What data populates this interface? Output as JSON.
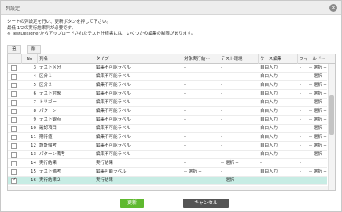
{
  "dialog": {
    "title": "列設定"
  },
  "notes": [
    "シートの列設定を行い、更新ボタンを押して下さい。",
    "最低 1つの実行結果列が必要です。",
    "※ TestDesignerからアップロードされたテスト仕様書には、いくつかの編集の制限があります。"
  ],
  "tabs": [
    "追加",
    "削除"
  ],
  "columns": [
    "No",
    "列名",
    "タイプ",
    "対象実行結⋯",
    "テスト環境",
    "ケース編集",
    "フィールド⋯"
  ],
  "rows": [
    {
      "checked": false,
      "no": "3",
      "name": "テスト区分",
      "type": "編集不可能ラベル",
      "target": "-",
      "env": "-",
      "edit": "自由入力",
      "field": "-"
    },
    {
      "checked": false,
      "no": "4",
      "name": "区分１",
      "type": "編集不可能ラベル",
      "target": "-",
      "env": "-",
      "edit": "自由入力",
      "field": "-"
    },
    {
      "checked": false,
      "no": "5",
      "name": "区分２",
      "type": "編集不可能ラベル",
      "target": "-",
      "env": "-",
      "edit": "自由入力",
      "field": "-"
    },
    {
      "checked": false,
      "no": "6",
      "name": "テスト対象",
      "type": "編集不可能ラベル",
      "target": "-",
      "env": "-",
      "edit": "自由入力",
      "field": "-"
    },
    {
      "checked": false,
      "no": "7",
      "name": "トリガー",
      "type": "編集不可能ラベル",
      "target": "-",
      "env": "-",
      "edit": "自由入力",
      "field": "-"
    },
    {
      "checked": false,
      "no": "8",
      "name": "パターン",
      "type": "編集不可能ラベル",
      "target": "-",
      "env": "-",
      "edit": "自由入力",
      "field": "-"
    },
    {
      "checked": false,
      "no": "9",
      "name": "テスト観点",
      "type": "編集不可能ラベル",
      "target": "-",
      "env": "-",
      "edit": "自由入力",
      "field": "-"
    },
    {
      "checked": false,
      "no": "10",
      "name": "確認項目",
      "type": "編集不可能ラベル",
      "target": "-",
      "env": "-",
      "edit": "自由入力",
      "field": "-"
    },
    {
      "checked": false,
      "no": "11",
      "name": "期待値",
      "type": "編集不可能ラベル",
      "target": "-",
      "env": "-",
      "edit": "自由入力",
      "field": "-"
    },
    {
      "checked": false,
      "no": "12",
      "name": "設計備考",
      "type": "編集不可能ラベル",
      "target": "-",
      "env": "-",
      "edit": "自由入力",
      "field": "-"
    },
    {
      "checked": false,
      "no": "13",
      "name": "パターン備考",
      "type": "編集不可能ラベル",
      "target": "-",
      "env": "-",
      "edit": "自由入力",
      "field": "-"
    },
    {
      "checked": false,
      "no": "14",
      "name": "実行結果",
      "type": "実行結果",
      "target": "-",
      "env": "-- 選択 --",
      "edit": "-",
      "field": "-"
    },
    {
      "checked": false,
      "no": "15",
      "name": "テスト備考",
      "type": "編集可能ラベル",
      "target": "-- 選択 --",
      "env": "-",
      "edit": "自由入力",
      "field": "-"
    },
    {
      "checked": true,
      "no": "16",
      "name": "実行結果２",
      "type": "実行結果",
      "target": "-",
      "env": "-- 選択 --",
      "edit": "-",
      "field": "-",
      "selected": true
    }
  ],
  "right_dropdown": "-- 選択 --",
  "buttons": {
    "update": "更新",
    "cancel": "キャンセル"
  },
  "colors": {
    "accent_green": "#5fb92f",
    "cancel_dark": "#555555",
    "selected_row": "#c7ece4"
  }
}
